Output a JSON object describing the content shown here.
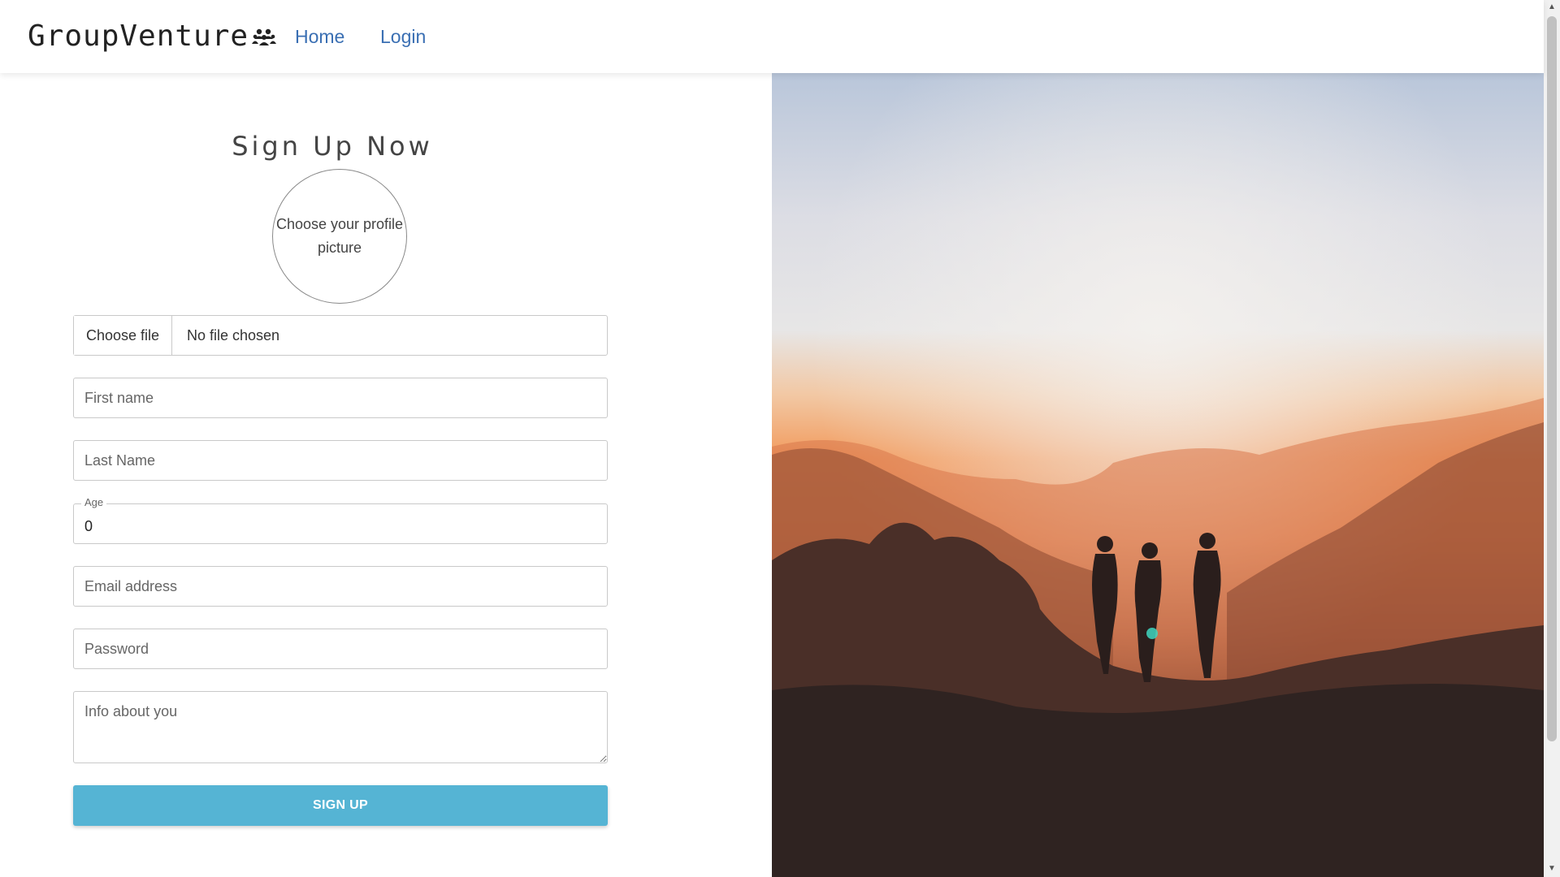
{
  "nav": {
    "brand": "GroupVenture",
    "brand_icon": "group-icon",
    "links": [
      {
        "label": "Home"
      },
      {
        "label": "Login"
      }
    ]
  },
  "form": {
    "title": "Sign Up Now",
    "avatar_prompt": "Choose your profile picture",
    "file": {
      "button_label": "Choose file",
      "status": "No file chosen"
    },
    "first_name": {
      "placeholder": "First name"
    },
    "last_name": {
      "placeholder": "Last Name"
    },
    "age": {
      "label": "Age",
      "value": "0"
    },
    "email": {
      "placeholder": "Email address"
    },
    "password": {
      "placeholder": "Password"
    },
    "info": {
      "placeholder": "Info about you"
    },
    "submit_label": "SIGN UP"
  },
  "colors": {
    "accent": "#55b4d4",
    "link": "#3a6fb3"
  }
}
